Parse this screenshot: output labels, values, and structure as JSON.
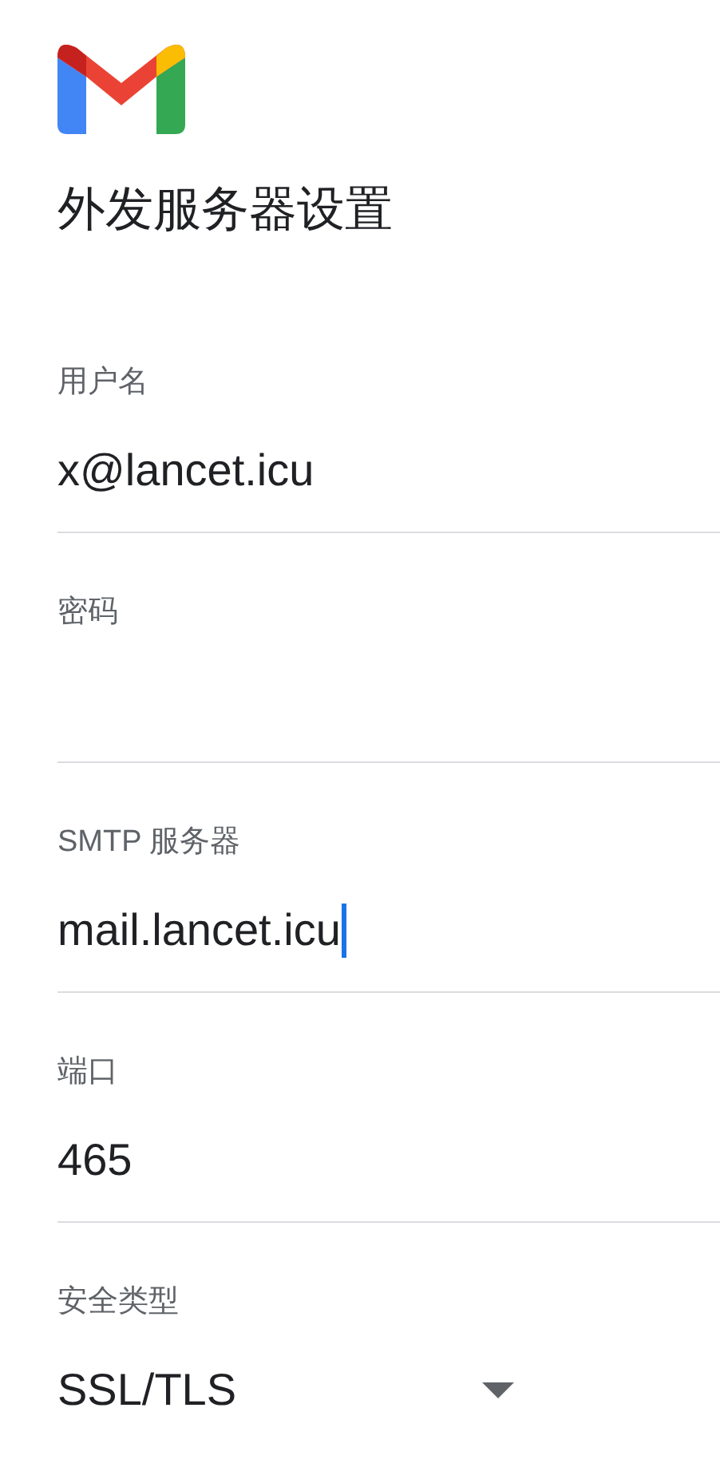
{
  "title": "外发服务器设置",
  "fields": [
    {
      "kind": "text",
      "label": "用户名",
      "value": "x@lancet.icu",
      "focused": false
    },
    {
      "kind": "password",
      "label": "密码",
      "focused": false
    },
    {
      "kind": "text",
      "label": "SMTP 服务器",
      "value": "mail.lancet.icu",
      "focused": true
    },
    {
      "kind": "text",
      "label": "端口",
      "value": "465",
      "focused": false
    },
    {
      "kind": "select",
      "label": "安全类型",
      "value": "SSL/TLS",
      "focused": false
    }
  ]
}
